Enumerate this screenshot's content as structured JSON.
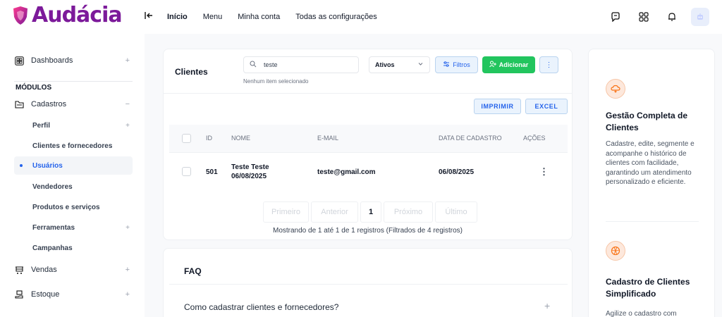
{
  "brand": {
    "name": "Audácia",
    "color": "#7c1a9a"
  },
  "topnav": [
    "Início",
    "Menu",
    "Minha conta",
    "Todas as configurações"
  ],
  "top_icons": [
    "chat-bubble-icon",
    "apps-grid-icon",
    "notification-bell-icon",
    "user-avatar-icon"
  ],
  "sidebar": {
    "dashboards": "Dashboards",
    "section": "MÓDULOS",
    "cadastros": "Cadastros",
    "sub": {
      "perfil": "Perfil",
      "clientes": "Clientes e fornecedores",
      "usuarios": "Usuários",
      "vendedores": "Vendedores",
      "produtos": "Produtos e serviços",
      "ferramentas": "Ferramentas",
      "campanhas": "Campanhas"
    },
    "vendas": "Vendas",
    "estoque": "Estoque"
  },
  "clients": {
    "title": "Clientes",
    "search_value": "teste",
    "selection_note": "Nenhum item selecionado",
    "status_select": "Ativos",
    "filters_label": "Filtros",
    "add_label": "Adicionar",
    "print_label": "IMPRIMIR",
    "excel_label": "EXCEL",
    "columns": {
      "id": "ID",
      "name": "NOME",
      "email": "E-MAIL",
      "date": "DATA DE CADASTRO",
      "actions": "AÇÕES"
    },
    "rows": [
      {
        "id": "501",
        "name": "Teste Teste",
        "name_date": "06/08/2025",
        "email": "teste@gmail.com",
        "date": "06/08/2025"
      }
    ],
    "pager": {
      "first": "Primeiro",
      "prev": "Anterior",
      "current": "1",
      "next": "Próximo",
      "last": "Último"
    },
    "pager_info": "Mostrando de 1 até 1 de 1 registros (Filtrados de 4 registros)"
  },
  "faq": {
    "title": "FAQ",
    "question": "Como cadastrar clientes e fornecedores?"
  },
  "features": [
    {
      "title": "Gestão Completa de Clientes",
      "text": "Cadastre, edite, segmente e acompanhe o histórico de clientes com facilidade, garantindo um atendimento personalizado e eficiente."
    },
    {
      "title": "Cadastro de Clientes Simplificado",
      "text": "Agilize o cadastro com"
    }
  ],
  "colors": {
    "accent": "#2563eb",
    "success": "#22c55e",
    "feature_icon": "#f97316"
  }
}
